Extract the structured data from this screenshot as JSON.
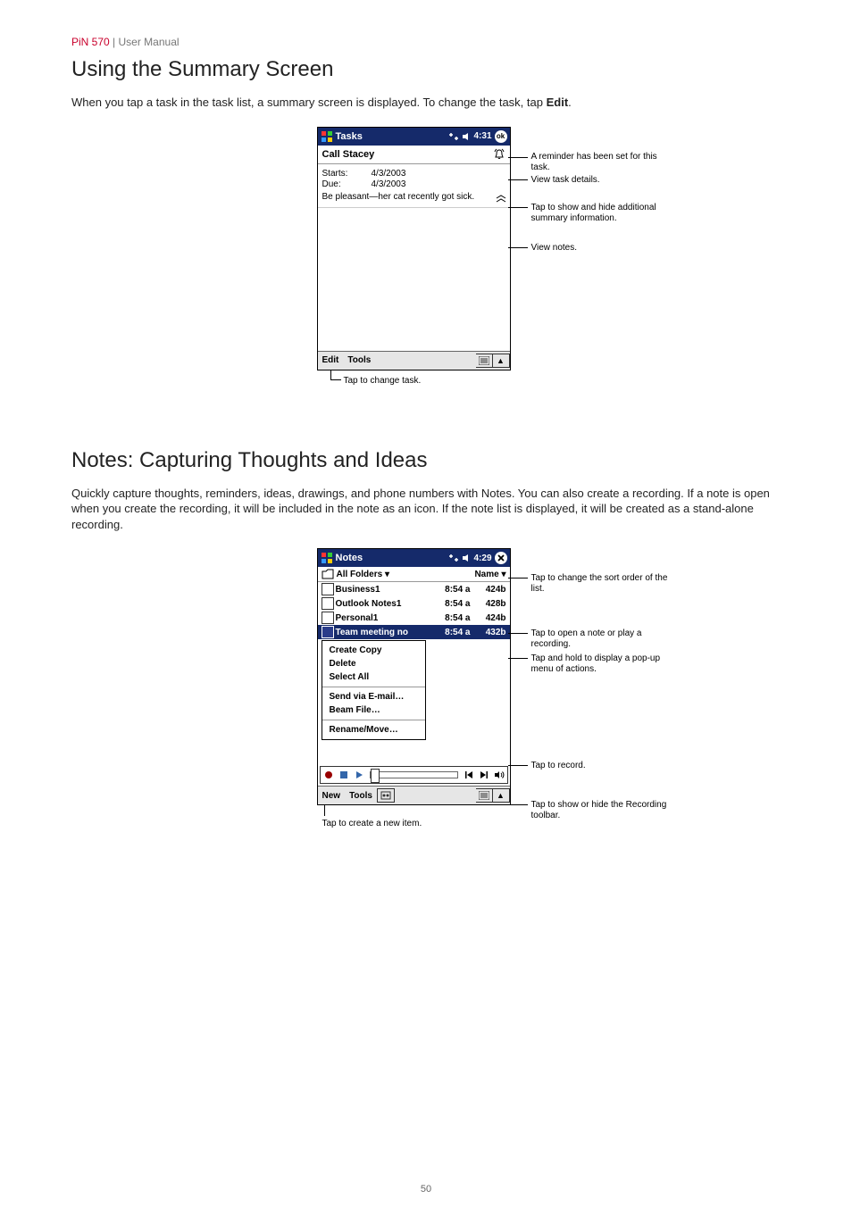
{
  "header": {
    "product": "PiN 570",
    "label": "User Manual"
  },
  "section1": {
    "title": "Using the Summary Screen",
    "body_prefix": "When you tap a task in the task list, a summary screen is displayed. To change the task, tap ",
    "body_bold": "Edit",
    "body_suffix": "."
  },
  "tasks_shot": {
    "title": "Tasks",
    "clock": "4:31",
    "ok_label": "ok",
    "task_title": "Call Stacey",
    "starts_label": "Starts:",
    "starts_value": "4/3/2003",
    "due_label": "Due:",
    "due_value": "4/3/2003",
    "note_text": "Be pleasant—her cat recently got sick.",
    "menubar": {
      "edit": "Edit",
      "tools": "Tools"
    },
    "callouts": {
      "reminder": "A reminder has been set for this task.",
      "viewdetails": "View task details.",
      "toggle": "Tap to show and hide additional summary information.",
      "viewnotes": "View notes."
    },
    "below_caption": "Tap to change task."
  },
  "section2": {
    "title": "Notes: Capturing Thoughts and Ideas",
    "body": "Quickly capture thoughts, reminders, ideas, drawings, and phone numbers with Notes. You can also create a recording. If a note is open when you create the recording, it will be included in the note as an icon. If the note list is displayed, it will be created as a stand-alone recording."
  },
  "notes_shot": {
    "title": "Notes",
    "clock": "4:29",
    "folder_label": "All Folders",
    "sort_label": "Name",
    "rows": [
      {
        "name": "Business1",
        "time": "8:54 a",
        "size": "424b"
      },
      {
        "name": "Outlook Notes1",
        "time": "8:54 a",
        "size": "428b"
      },
      {
        "name": "Personal1",
        "time": "8:54 a",
        "size": "424b"
      },
      {
        "name": "Team meeting no",
        "time": "8:54 a",
        "size": "432b"
      }
    ],
    "ctx_menu": {
      "create_copy": "Create Copy",
      "delete": "Delete",
      "select_all": "Select All",
      "send_email": "Send via E-mail…",
      "beam": "Beam File…",
      "rename": "Rename/Move…"
    },
    "menubar": {
      "new": "New",
      "tools": "Tools"
    },
    "callouts": {
      "sort": "Tap to change the sort order of the list.",
      "open": "Tap to open a note or play a recording.",
      "hold": "Tap and hold to display a pop-up menu of actions.",
      "record": "Tap to record.",
      "showhide": "Tap to show or hide the Recording toolbar."
    },
    "below_caption": "Tap to create a new item."
  },
  "page_number": "50"
}
